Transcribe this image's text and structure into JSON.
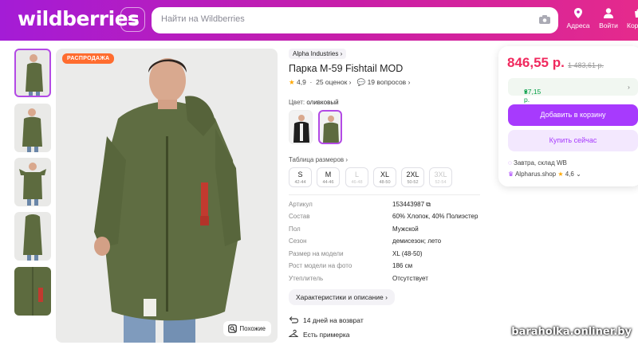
{
  "header": {
    "logo": "wildberries",
    "search_placeholder": "Найти на Wildberries",
    "nav": [
      {
        "label": "Адреса",
        "icon": "location-pin-icon"
      },
      {
        "label": "Войти",
        "icon": "user-icon"
      },
      {
        "label": "Кор",
        "icon": "cart-icon"
      }
    ]
  },
  "gallery": {
    "badge": "РАСПРОДАЖА",
    "similar_label": "Похожие",
    "thumbnail_count": 5
  },
  "product": {
    "brand": "Alpha Industries",
    "title": "Парка M-59 Fishtail MOD",
    "rating": "4,9",
    "reviews": "25 оценок",
    "questions": "19 вопросов",
    "color_label": "Цвет:",
    "color_value": "оливковый",
    "size_table_label": "Таблица размеров",
    "sizes": [
      {
        "size": "S",
        "range": "42-44",
        "available": true
      },
      {
        "size": "M",
        "range": "44-46",
        "available": true
      },
      {
        "size": "L",
        "range": "46-48",
        "available": false
      },
      {
        "size": "XL",
        "range": "48-50",
        "available": true
      },
      {
        "size": "2XL",
        "range": "50-52",
        "available": true
      },
      {
        "size": "3XL",
        "range": "52-54",
        "available": false
      }
    ],
    "specs": [
      {
        "k": "Артикул",
        "v": "153443987"
      },
      {
        "k": "Состав",
        "v": "60% Хлопок, 40% Полиэстер"
      },
      {
        "k": "Пол",
        "v": "Мужской"
      },
      {
        "k": "Сезон",
        "v": "демисезон; лето"
      },
      {
        "k": "Размер на модели",
        "v": "XL (48-50)"
      },
      {
        "k": "Рост модели на фото",
        "v": "186 см"
      },
      {
        "k": "Утеплитель",
        "v": "Отсутствует"
      }
    ],
    "details_button": "Характеристики и описание",
    "features": [
      "14 дней на возврат",
      "Есть примерка"
    ]
  },
  "buybox": {
    "price": "846,55 р.",
    "old_price": "1 483,61 р.",
    "wallet_price": "37,15 р.",
    "add_to_cart": "Добавить в корзину",
    "buy_now": "Купить сейчас",
    "delivery": "Завтра, склад WB",
    "seller": "Alpharus.shop",
    "seller_rating": "4,6"
  },
  "watermark": "baraholka.onliner.by",
  "colors": {
    "brand_purple": "#a73afd",
    "price_red": "#f0295e",
    "sale_orange": "#ff6c2f",
    "wallet_green": "#0aa14b"
  }
}
